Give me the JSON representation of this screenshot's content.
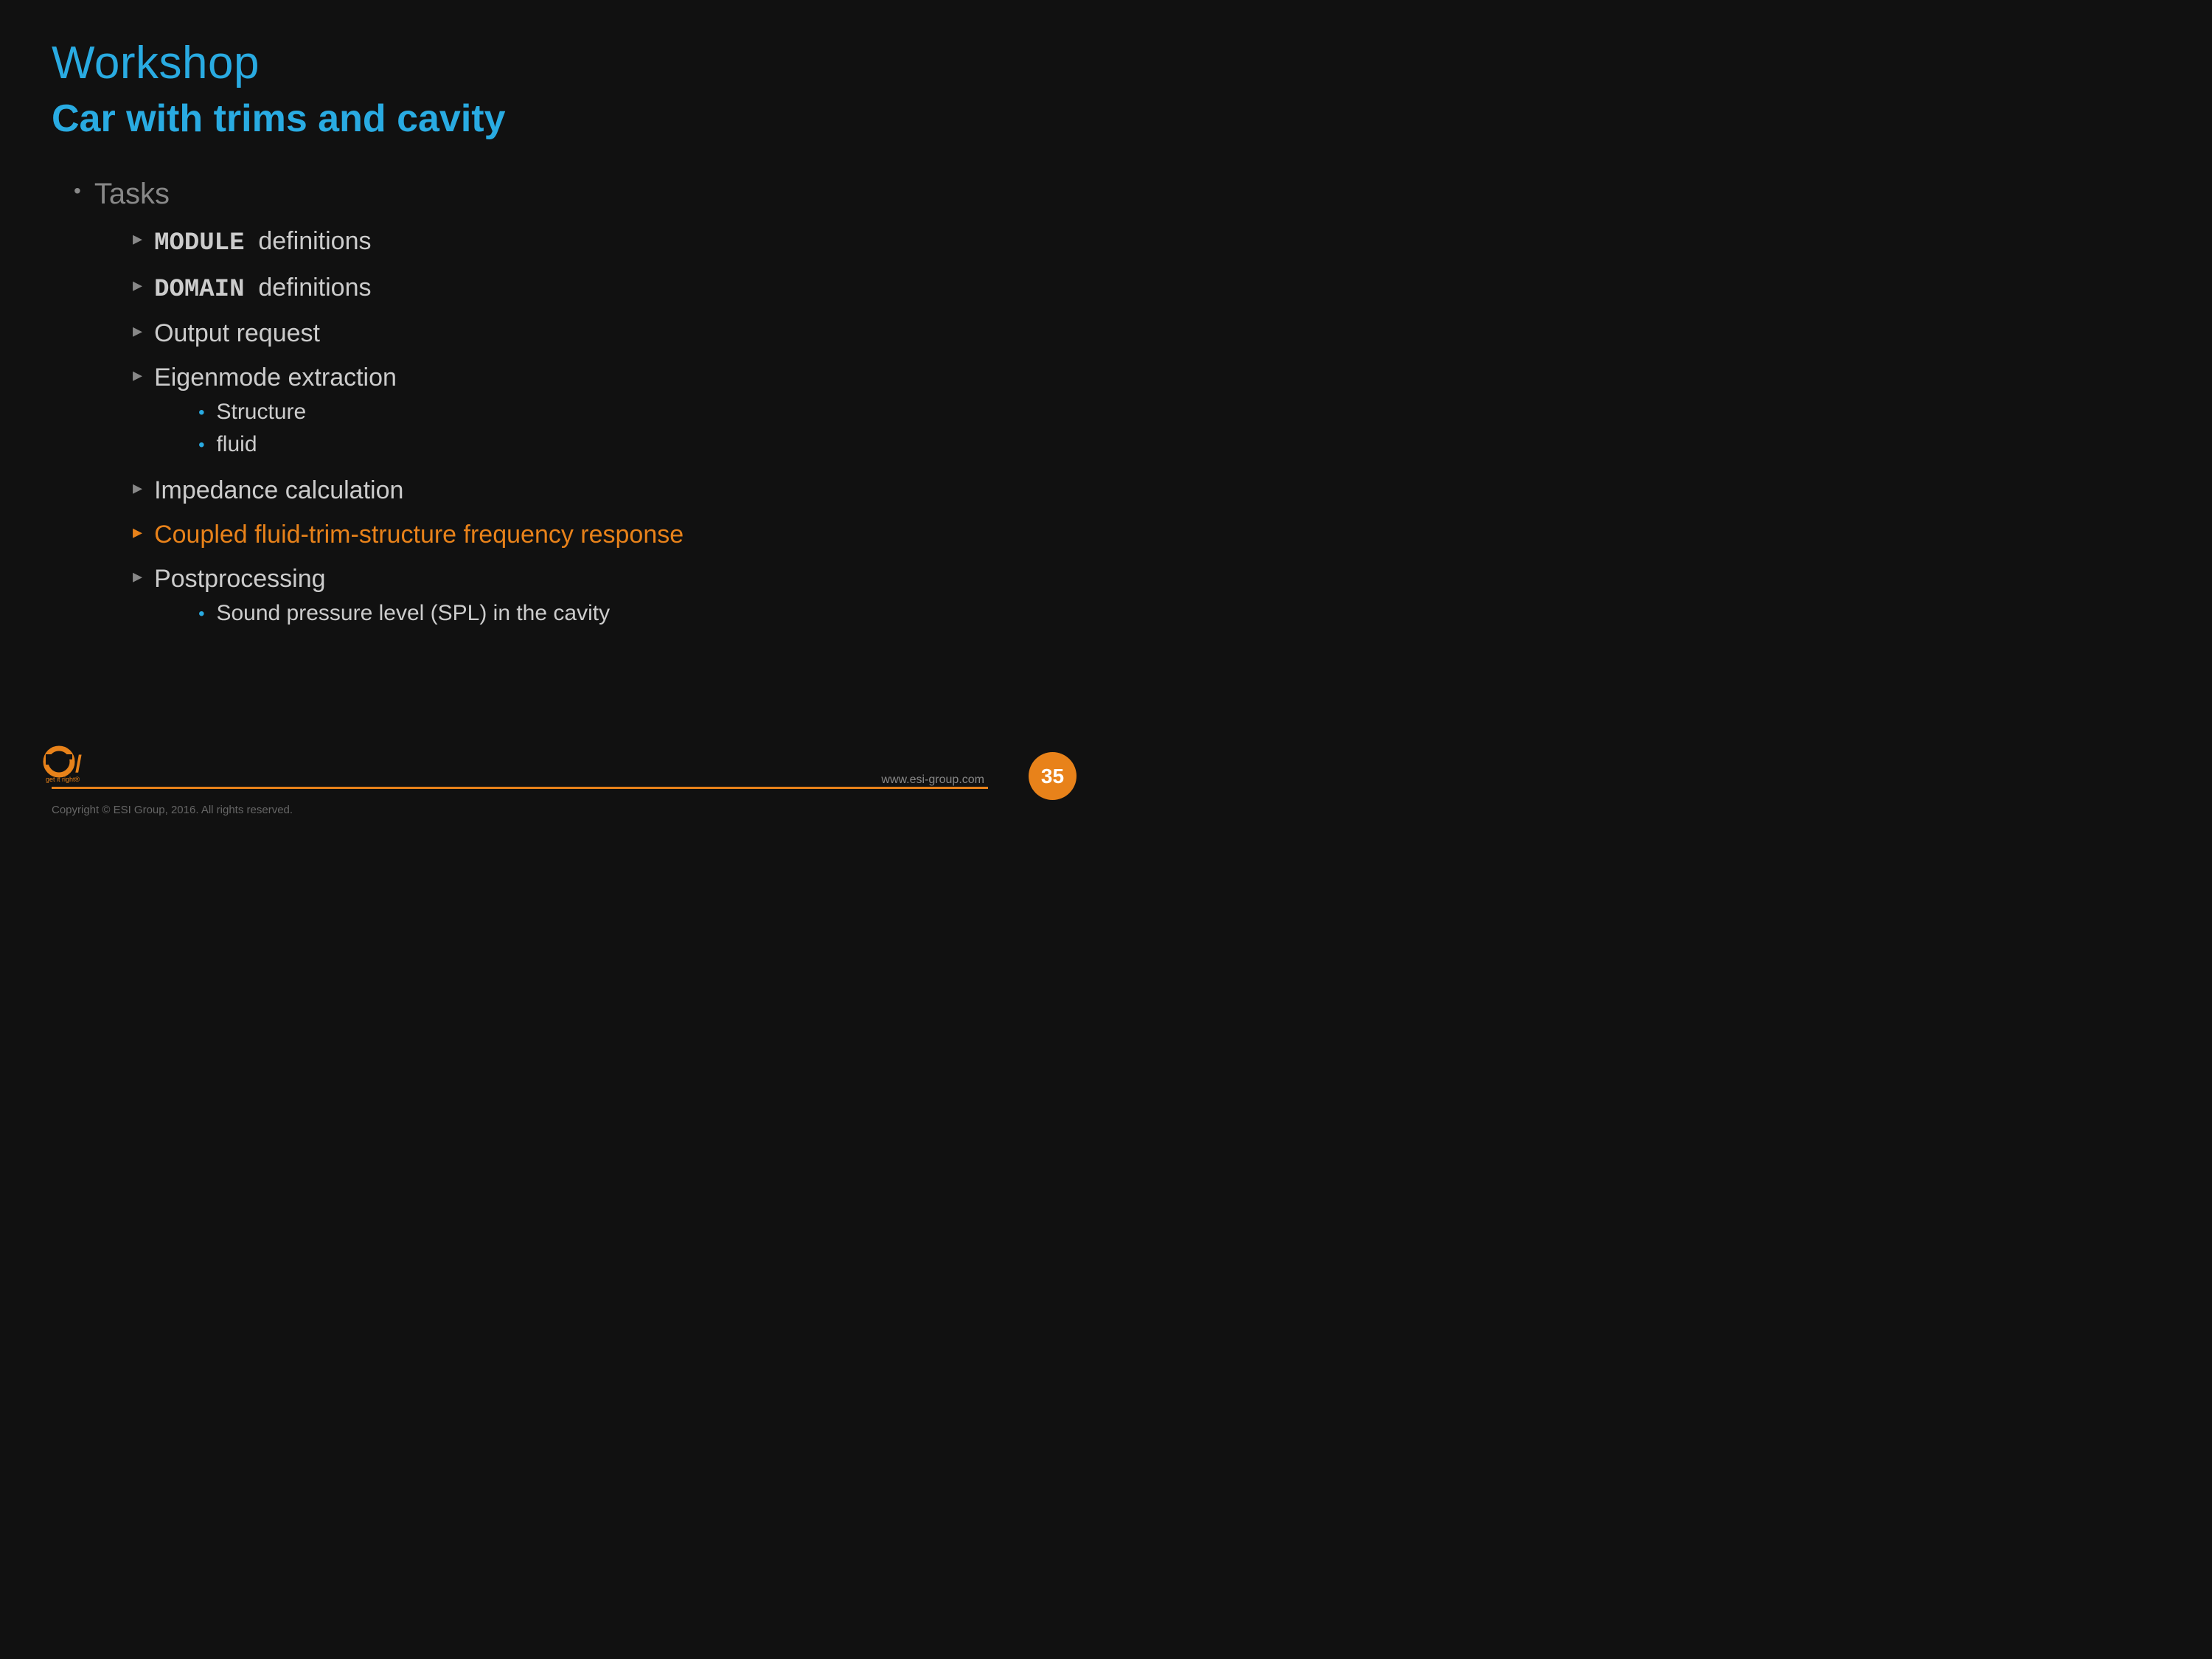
{
  "slide": {
    "title": "Workshop",
    "subtitle": "Car with trims and cavity",
    "top_bullet_label": "Tasks",
    "sub_items": [
      {
        "id": "module",
        "keyword": "MODULE",
        "rest": "  definitions",
        "highlighted": false,
        "has_nested": false
      },
      {
        "id": "domain",
        "keyword": "DOMAIN",
        "rest": "  definitions",
        "highlighted": false,
        "has_nested": false
      },
      {
        "id": "output",
        "keyword": null,
        "rest": "Output request",
        "highlighted": false,
        "has_nested": false
      },
      {
        "id": "eigenmode",
        "keyword": null,
        "rest": "Eigenmode extraction",
        "highlighted": false,
        "has_nested": true,
        "nested": [
          "Structure",
          "fluid"
        ]
      },
      {
        "id": "impedance",
        "keyword": null,
        "rest": "Impedance calculation",
        "highlighted": false,
        "has_nested": false
      },
      {
        "id": "coupled",
        "keyword": null,
        "rest": "Coupled fluid-trim-structure frequency response",
        "highlighted": true,
        "has_nested": false
      },
      {
        "id": "postprocessing",
        "keyword": null,
        "rest": "Postprocessing",
        "highlighted": false,
        "has_nested": true,
        "nested": [
          "Sound pressure level (SPL) in the cavity"
        ]
      }
    ]
  },
  "footer": {
    "url": "www.esi-group.com",
    "page_number": "35",
    "copyright": "Copyright © ESI Group, 2016. All rights reserved."
  }
}
